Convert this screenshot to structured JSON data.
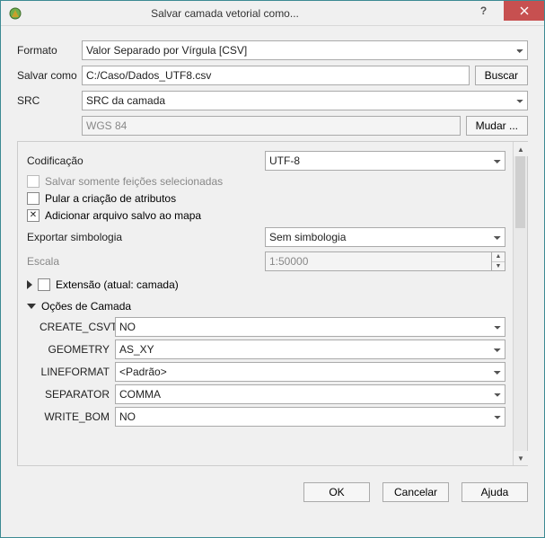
{
  "window": {
    "title": "Salvar camada vetorial como..."
  },
  "labels": {
    "formato": "Formato",
    "salvar_como": "Salvar como",
    "src": "SRC",
    "buscar": "Buscar",
    "mudar": "Mudar ...",
    "codificacao": "Codificação",
    "salvar_selecionadas": "Salvar somente feições selecionadas",
    "pular_atributos": "Pular a criação de atributos",
    "add_ao_mapa": "Adicionar arquivo salvo ao mapa",
    "exportar_simbologia": "Exportar simbologia",
    "escala": "Escala",
    "extensao": "Extensão (atual: camada)",
    "opcoes_camada": "Oções de Camada"
  },
  "values": {
    "formato": "Valor Separado por Vírgula [CSV]",
    "salvar_como": "C:/Caso/Dados_UTF8.csv",
    "src": "SRC da camada",
    "src_text": "WGS 84",
    "codificacao": "UTF-8",
    "simbologia": "Sem simbologia",
    "escala": "1:50000"
  },
  "checkboxes": {
    "selecionadas": false,
    "pular_atributos": false,
    "add_ao_mapa": true,
    "extensao": false
  },
  "layer_options": {
    "create_csvt": {
      "label": "CREATE_CSVT",
      "value": "NO"
    },
    "geometry": {
      "label": "GEOMETRY",
      "value": "AS_XY"
    },
    "lineformat": {
      "label": "LINEFORMAT",
      "value": "<Padrão>"
    },
    "separator": {
      "label": "SEPARATOR",
      "value": "COMMA"
    },
    "write_bom": {
      "label": "WRITE_BOM",
      "value": "NO"
    }
  },
  "buttons": {
    "ok": "OK",
    "cancelar": "Cancelar",
    "ajuda": "Ajuda"
  }
}
